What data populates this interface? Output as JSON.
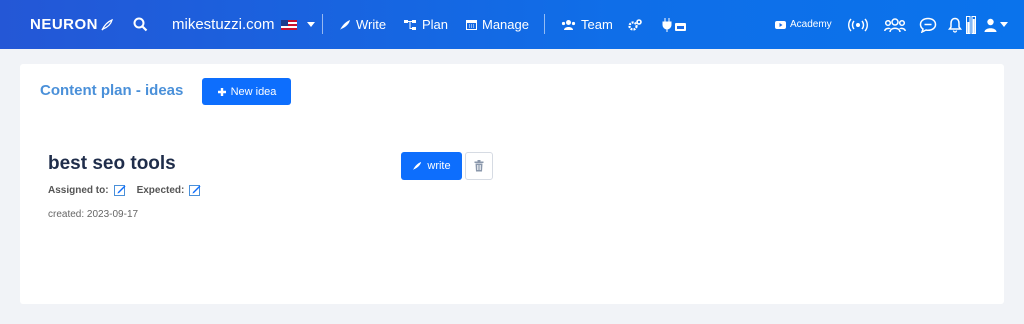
{
  "header": {
    "brand": "NEURON",
    "site": "mikestuzzi.com",
    "nav": {
      "write": "Write",
      "plan": "Plan",
      "manage": "Manage",
      "team": "Team"
    },
    "academy": "Academy"
  },
  "page": {
    "title": "Content plan - ideas",
    "new_idea_label": "New idea"
  },
  "idea": {
    "title": "best seo tools",
    "assigned_label": "Assigned to:",
    "expected_label": "Expected:",
    "created": "created: 2023-09-17",
    "write_label": "write"
  },
  "colors": {
    "primary": "#0d6efd",
    "header_start": "#2457d6",
    "title_blue": "#4a90d9"
  }
}
